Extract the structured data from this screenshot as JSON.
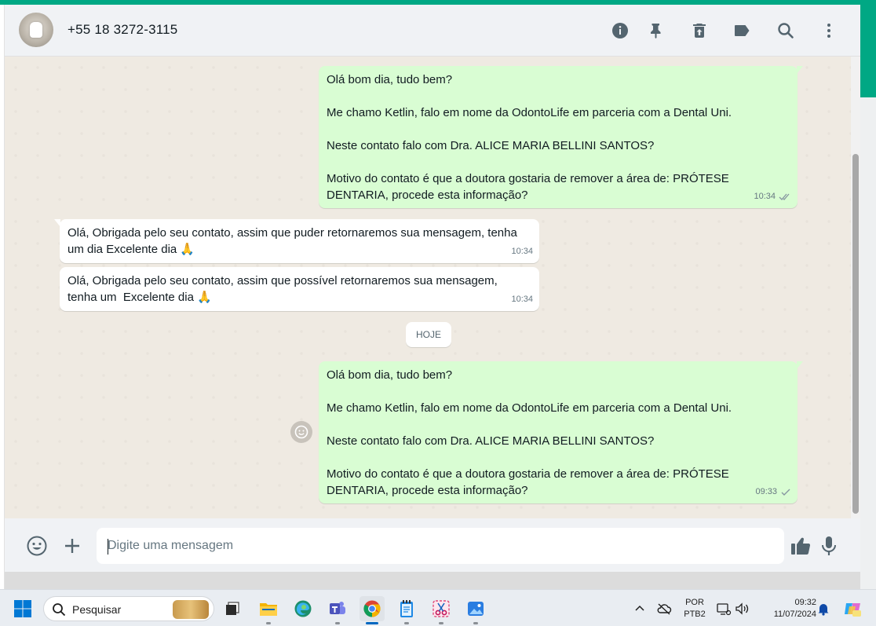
{
  "chat": {
    "contact_name": "+55 18 3272-3115",
    "header_icons": [
      "info-icon",
      "pin-icon",
      "delete-icon",
      "label-icon",
      "search-icon",
      "menu-dots-icon"
    ]
  },
  "messages": [
    {
      "direction": "out",
      "lines": [
        "Olá bom dia, tudo bem?",
        "",
        "Me chamo Ketlin, falo em nome da OdontoLife em parceria com a Dental Uni.",
        "",
        "Neste contato falo com Dra. ALICE MARIA BELLINI SANTOS?",
        "",
        "Motivo do contato é que a doutora gostaria de remover a área de: PRÓTESE",
        "DENTARIA, procede esta informação?"
      ],
      "time": "10:34",
      "status": "read"
    },
    {
      "direction": "in",
      "lines": [
        "Olá, Obrigada pelo seu contato, assim que puder retornaremos sua mensagem, tenha",
        "um dia Excelente dia 🙏"
      ],
      "time": "10:34"
    },
    {
      "direction": "in",
      "lines": [
        "Olá, Obrigada pelo seu contato, assim que possível retornaremos sua mensagem,",
        "tenha um  Excelente dia 🙏"
      ],
      "time": "10:34"
    },
    {
      "direction": "out",
      "lines": [
        "Olá bom dia, tudo bem?",
        "",
        "Me chamo Ketlin, falo em nome da OdontoLife em parceria com a Dental Uni.",
        "",
        "Neste contato falo com Dra. ALICE MARIA BELLINI SANTOS?",
        "",
        "Motivo do contato é que a doutora gostaria de remover a área de: PRÓTESE",
        "DENTARIA, procede esta informação?"
      ],
      "time": "09:33",
      "status": "sent"
    }
  ],
  "day_separator": "HOJE",
  "composer": {
    "placeholder": "Digite uma mensagem"
  },
  "taskbar": {
    "search_label": "Pesquisar",
    "language": "POR",
    "keyboard": "PTB2",
    "time": "09:32",
    "date": "11/07/2024"
  },
  "colors": {
    "accent": "#00a884",
    "outgoing_bubble": "#d9fdd3",
    "incoming_bubble": "#ffffff",
    "chat_background": "#efeae2",
    "header_background": "#f0f2f5",
    "read_tick": "#53bdeb"
  }
}
